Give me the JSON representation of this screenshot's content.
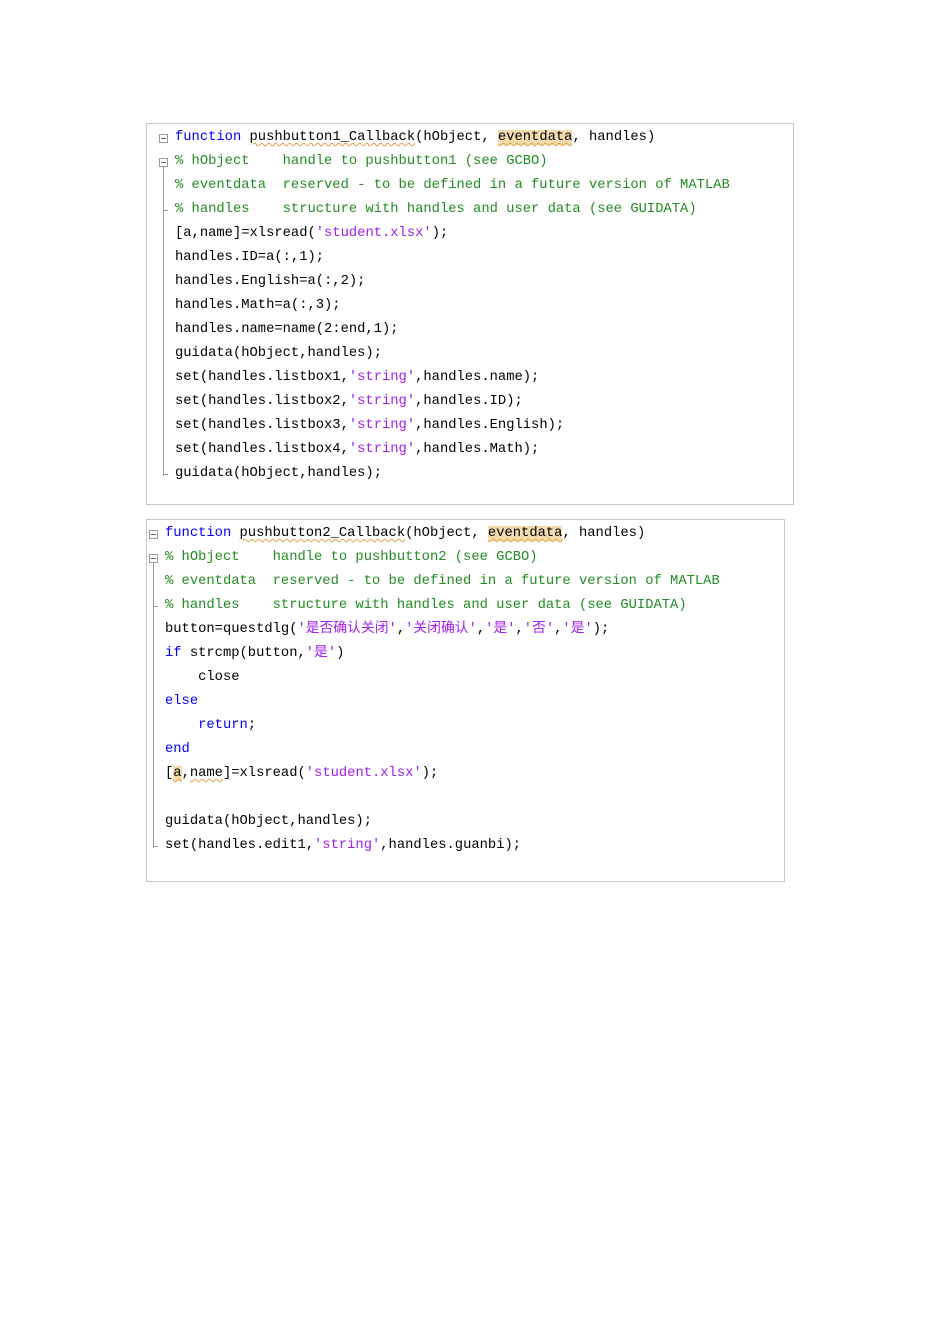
{
  "panels": [
    {
      "lines": [
        [
          {
            "t": "function",
            "k": "kw"
          },
          {
            "t": " "
          },
          {
            "t": "pushbutton1_Callback",
            "k": "sq"
          },
          {
            "t": "(hObject, "
          },
          {
            "t": "eventdata",
            "k": "hl sq"
          },
          {
            "t": ", handles)"
          }
        ],
        [
          {
            "t": "% hObject    handle to pushbutton1 (see GCBO)",
            "k": "cm"
          }
        ],
        [
          {
            "t": "% eventdata  reserved - to be defined in a future version of MATLAB",
            "k": "cm"
          }
        ],
        [
          {
            "t": "% handles    structure with handles and user data (see GUIDATA)",
            "k": "cm"
          }
        ],
        [
          {
            "t": "[a,name]=xlsread("
          },
          {
            "t": "'student.xlsx'",
            "k": "str"
          },
          {
            "t": ");"
          }
        ],
        [
          {
            "t": "handles.ID=a(:,1);"
          }
        ],
        [
          {
            "t": "handles.English=a(:,2);"
          }
        ],
        [
          {
            "t": "handles.Math=a(:,3);"
          }
        ],
        [
          {
            "t": "handles.name=name(2:end,1);"
          }
        ],
        [
          {
            "t": "guidata(hObject,handles);"
          }
        ],
        [
          {
            "t": "set(handles.listbox1,"
          },
          {
            "t": "'string'",
            "k": "str"
          },
          {
            "t": ",handles.name);"
          }
        ],
        [
          {
            "t": "set(handles.listbox2,"
          },
          {
            "t": "'string'",
            "k": "str"
          },
          {
            "t": ",handles.ID);"
          }
        ],
        [
          {
            "t": "set(handles.listbox3,"
          },
          {
            "t": "'string'",
            "k": "str"
          },
          {
            "t": ",handles.English);"
          }
        ],
        [
          {
            "t": "set(handles.listbox4,"
          },
          {
            "t": "'string'",
            "k": "str"
          },
          {
            "t": ",handles.Math);"
          }
        ],
        [
          {
            "t": "guidata(hObject,handles);"
          }
        ]
      ]
    },
    {
      "lines": [
        [
          {
            "t": "function",
            "k": "kw"
          },
          {
            "t": " "
          },
          {
            "t": "pushbutton2_Callback",
            "k": "sq"
          },
          {
            "t": "(hObject, "
          },
          {
            "t": "eventdata",
            "k": "hl sq"
          },
          {
            "t": ", handles)"
          }
        ],
        [
          {
            "t": "% hObject    handle to pushbutton2 (see GCBO)",
            "k": "cm"
          }
        ],
        [
          {
            "t": "% eventdata  reserved - to be defined in a future version of MATLAB",
            "k": "cm"
          }
        ],
        [
          {
            "t": "% handles    structure with handles and user data (see GUIDATA)",
            "k": "cm"
          }
        ],
        [
          {
            "t": "button=questdlg("
          },
          {
            "t": "'是否确认关闭'",
            "k": "str"
          },
          {
            "t": ","
          },
          {
            "t": "'关闭确认'",
            "k": "str"
          },
          {
            "t": ","
          },
          {
            "t": "'是'",
            "k": "str"
          },
          {
            "t": ","
          },
          {
            "t": "'否'",
            "k": "str"
          },
          {
            "t": ","
          },
          {
            "t": "'是'",
            "k": "str"
          },
          {
            "t": ");"
          }
        ],
        [
          {
            "t": "if",
            "k": "kw"
          },
          {
            "t": " strcmp(button,"
          },
          {
            "t": "'是'",
            "k": "str"
          },
          {
            "t": ")"
          }
        ],
        [
          {
            "t": "    close"
          }
        ],
        [
          {
            "t": "else",
            "k": "kw"
          }
        ],
        [
          {
            "t": "    "
          },
          {
            "t": "return",
            "k": "kw"
          },
          {
            "t": ";"
          }
        ],
        [
          {
            "t": "end",
            "k": "kw"
          }
        ],
        [
          {
            "t": "["
          },
          {
            "t": "a",
            "k": "hl sq"
          },
          {
            "t": ","
          },
          {
            "t": "name",
            "k": "sq"
          },
          {
            "t": "]=xlsread("
          },
          {
            "t": "'student.xlsx'",
            "k": "str"
          },
          {
            "t": ");"
          }
        ],
        [
          {
            "t": ""
          }
        ],
        [
          {
            "t": "guidata(hObject,handles);"
          }
        ],
        [
          {
            "t": "set(handles.edit1,"
          },
          {
            "t": "'string'",
            "k": "str"
          },
          {
            "t": ",handles.guanbi);"
          }
        ]
      ]
    }
  ]
}
